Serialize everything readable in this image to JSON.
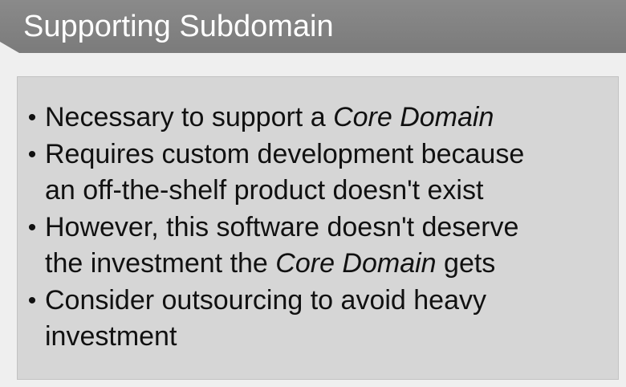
{
  "slide": {
    "title": "Supporting Subdomain",
    "bullets": [
      {
        "lines": [
          {
            "before": "Necessary to support a ",
            "emphasis": "Core Domain",
            "after": ""
          }
        ]
      },
      {
        "lines": [
          {
            "before": "Requires custom development because",
            "emphasis": "",
            "after": ""
          },
          {
            "before": "an off-the-shelf product doesn't exist",
            "emphasis": "",
            "after": ""
          }
        ]
      },
      {
        "lines": [
          {
            "before": "However, this software doesn't deserve",
            "emphasis": "",
            "after": ""
          },
          {
            "before": "the investment the ",
            "emphasis": "Core Domain",
            "after": " gets"
          }
        ]
      },
      {
        "lines": [
          {
            "before": "Consider outsourcing to avoid heavy",
            "emphasis": "",
            "after": ""
          },
          {
            "before": "investment",
            "emphasis": "",
            "after": ""
          }
        ]
      }
    ],
    "bullet_glyph": "•"
  }
}
